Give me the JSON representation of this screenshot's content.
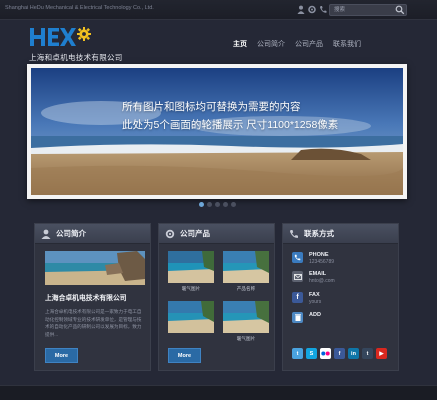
{
  "topbar": {
    "company_en": "Shanghai HeDu Mechanical & Electrical Technology Co., Ltd.",
    "search_placeholder": "搜索"
  },
  "header": {
    "company_name": "上海和卓机电技术有限公司",
    "nav": [
      "主页",
      "公司简介",
      "公司产品",
      "联系我们"
    ]
  },
  "slider": {
    "line1": "所有图片和图标均可替换为需要的内容",
    "line2": "此处为5个画面的轮播展示 尺寸1100*1258像素",
    "dots": 5,
    "active_dot": 1
  },
  "about": {
    "heading": "公司简介",
    "title": "上海合卓机电技术有限公司",
    "body": "上海合卓机电技术有限公司是一家致力于电工自动化控制领域专业的技术研发单位，是管理与技术的自动化产品的研制公司以发展为目标，致力提供...",
    "more": "More"
  },
  "products": {
    "heading": "公司产品",
    "items": [
      "暖气图片",
      "产品名称",
      "",
      "暖气图片"
    ],
    "more": "More"
  },
  "contact": {
    "heading": "联系方式",
    "rows": [
      {
        "label": "PHONE",
        "value": "123456789"
      },
      {
        "label": "EMAIL",
        "value": "hnto@.com"
      },
      {
        "label": "FAX",
        "value": "yours"
      },
      {
        "label": "ADD",
        "value": ""
      }
    ],
    "social_icons": [
      "twitter-icon",
      "skype-icon",
      "flickr-icon",
      "facebook-icon",
      "linkedin-icon",
      "tumblr-icon",
      "youtube-icon"
    ],
    "colors": {
      "phone": "#3a7bbf",
      "email": "#5d6270",
      "fax": "#3b5998",
      "add": "#4d88c2"
    }
  },
  "colors": {
    "background": "#252836",
    "panel": "#30333f",
    "accent": "#2a6aa5",
    "logo_blue": "#1f7fcf",
    "logo_yellow": "#f0c020"
  }
}
